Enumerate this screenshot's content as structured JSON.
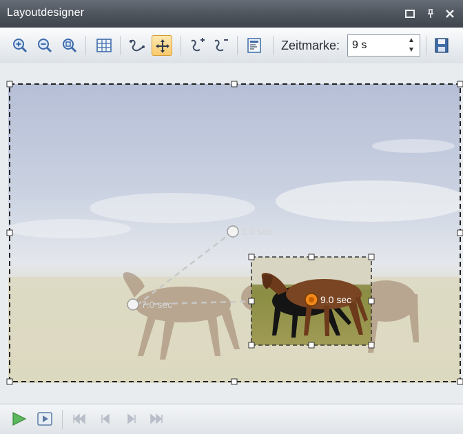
{
  "window": {
    "title": "Layoutdesigner",
    "controls": {
      "minimize": "▬",
      "pin": "⊥",
      "close": "x"
    }
  },
  "toolbar": {
    "tools": [
      "zoom-in-icon",
      "zoom-out-icon",
      "zoom-fit-icon",
      "grid-icon",
      "motion-path-icon",
      "move-icon",
      "add-keyframe-icon",
      "remove-keyframe-icon",
      "align-icon"
    ],
    "active_tool": "move-icon",
    "zeitmarke_label": "Zeitmarke:",
    "zeitmarke_value": "9 s",
    "save_icon": "save-icon"
  },
  "canvas": {
    "keyframes": [
      {
        "label": "3.0 sec",
        "state": "past"
      },
      {
        "label": "7.0 sec",
        "state": "past"
      },
      {
        "label": "9.0 sec",
        "state": "current"
      }
    ]
  },
  "playback": {
    "buttons": [
      "play-icon",
      "play-selection-icon",
      "first-frame-icon",
      "previous-frame-icon",
      "next-frame-icon",
      "last-frame-icon"
    ]
  },
  "colors": {
    "title_bar": "#4d535b",
    "active_tool": "#f8c96c",
    "current_keyframe": "#f08a1e"
  }
}
